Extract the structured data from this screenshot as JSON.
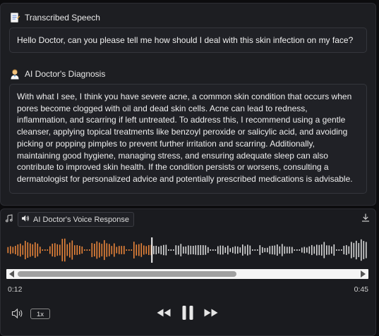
{
  "speech": {
    "icon": "memo-icon",
    "label": "Transcribed Speech",
    "text": "Hello Doctor, can you please tell me how should I deal with this skin infection on my face?"
  },
  "diagnosis": {
    "icon": "doctor-emoji-icon",
    "label": "AI Doctor's Diagnosis",
    "text": "With what I see, I think you have severe acne, a common skin condition that occurs when pores become clogged with oil and dead skin cells. Acne can lead to redness, inflammation, and scarring if left untreated. To address this, I recommend using a gentle cleanser, applying topical treatments like benzoyl peroxide or salicylic acid, and avoiding picking or popping pimples to prevent further irritation and scarring. Additionally, maintaining good hygiene, managing stress, and ensuring adequate sleep can also contribute to improved skin health. If the condition persists or worsens, consulting a dermatologist for personalized advice and potentially prescribed medications is advisable."
  },
  "audio": {
    "label": "AI Doctor's Voice Response",
    "current_time": "0:12",
    "total_time": "0:45",
    "played_fraction": 0.4,
    "speed": "1x",
    "played_color": "#e8843a",
    "unplayed_color": "#d8d8d8"
  }
}
